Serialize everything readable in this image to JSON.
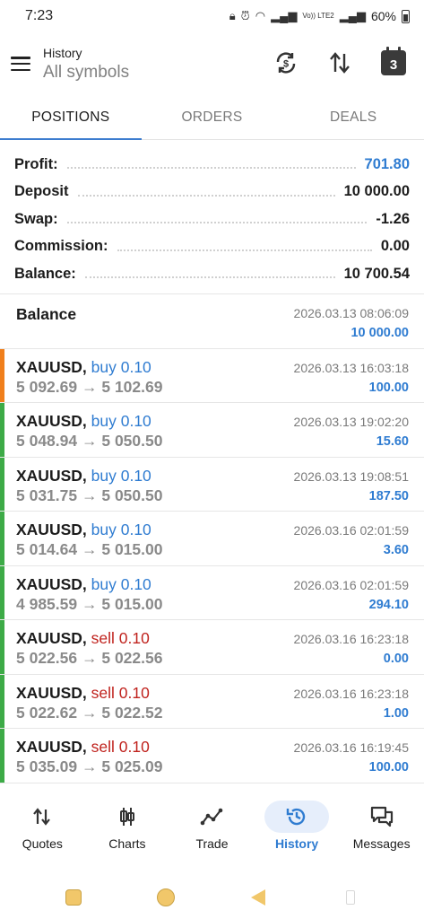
{
  "status_bar": {
    "time": "7:23",
    "network": "Vo)) LTE2",
    "battery": "60%"
  },
  "header": {
    "title": "History",
    "subtitle": "All symbols",
    "calendar_day": "3"
  },
  "tabs": [
    {
      "label": "POSITIONS",
      "active": true
    },
    {
      "label": "ORDERS",
      "active": false
    },
    {
      "label": "DEALS",
      "active": false
    }
  ],
  "summary": [
    {
      "label": "Profit:",
      "value": "701.80",
      "color": "#2f7cd1"
    },
    {
      "label": "Deposit",
      "value": "10 000.00"
    },
    {
      "label": "Swap:",
      "value": "-1.26"
    },
    {
      "label": "Commission:",
      "value": "0.00"
    },
    {
      "label": "Balance:",
      "value": "10 700.54"
    }
  ],
  "balance_entry": {
    "label": "Balance",
    "time": "2026.03.13 08:06:09",
    "amount": "10 000.00"
  },
  "positions": [
    {
      "symbol": "XAUUSD,",
      "direction": "buy 0.10",
      "type": "buy",
      "prices": "5 092.69 → 5 102.69",
      "time": "2026.03.13 16:03:18",
      "profit": "100.00",
      "stripe": "#f07f1c"
    },
    {
      "symbol": "XAUUSD,",
      "direction": "buy 0.10",
      "type": "buy",
      "prices": "5 048.94 → 5 050.50",
      "time": "2026.03.13 19:02:20",
      "profit": "15.60",
      "stripe": "#3dab47"
    },
    {
      "symbol": "XAUUSD,",
      "direction": "buy 0.10",
      "type": "buy",
      "prices": "5 031.75 → 5 050.50",
      "time": "2026.03.13 19:08:51",
      "profit": "187.50",
      "stripe": "#3dab47"
    },
    {
      "symbol": "XAUUSD,",
      "direction": "buy 0.10",
      "type": "buy",
      "prices": "5 014.64 → 5 015.00",
      "time": "2026.03.16 02:01:59",
      "profit": "3.60",
      "stripe": "#3dab47"
    },
    {
      "symbol": "XAUUSD,",
      "direction": "buy 0.10",
      "type": "buy",
      "prices": "4 985.59 → 5 015.00",
      "time": "2026.03.16 02:01:59",
      "profit": "294.10",
      "stripe": "#3dab47"
    },
    {
      "symbol": "XAUUSD,",
      "direction": "sell 0.10",
      "type": "sell",
      "prices": "5 022.56 → 5 022.56",
      "time": "2026.03.16 16:23:18",
      "profit": "0.00",
      "stripe": "#3dab47"
    },
    {
      "symbol": "XAUUSD,",
      "direction": "sell 0.10",
      "type": "sell",
      "prices": "5 022.62 → 5 022.52",
      "time": "2026.03.16 16:23:18",
      "profit": "1.00",
      "stripe": "#3dab47"
    },
    {
      "symbol": "XAUUSD,",
      "direction": "sell 0.10",
      "type": "sell",
      "prices": "5 035.09 → 5 025.09",
      "time": "2026.03.16 16:19:45",
      "profit": "100.00",
      "stripe": "#3dab47"
    }
  ],
  "bottom_nav": [
    {
      "label": "Quotes",
      "icon": "quotes-icon",
      "active": false
    },
    {
      "label": "Charts",
      "icon": "charts-icon",
      "active": false
    },
    {
      "label": "Trade",
      "icon": "trade-icon",
      "active": false
    },
    {
      "label": "History",
      "icon": "history-icon",
      "active": true
    },
    {
      "label": "Messages",
      "icon": "messages-icon",
      "active": false
    }
  ],
  "colors": {
    "accent": "#2f7cd1",
    "sell": "#c0231e",
    "profit_stripe": "#3dab47",
    "open_stripe": "#f07f1c"
  }
}
